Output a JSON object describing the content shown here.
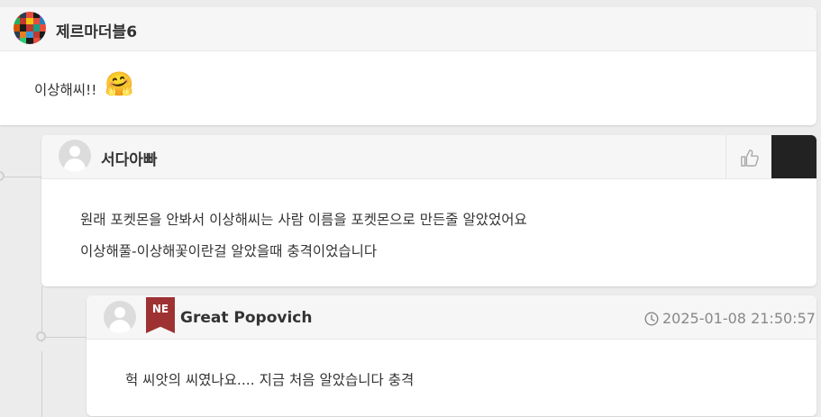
{
  "comments": [
    {
      "author": "제르마더블6",
      "text": "이상해씨!!",
      "emoji": "🤗"
    },
    {
      "author": "서다아빠",
      "lines": [
        "원래 포켓몬을 안봐서 이상해씨는 사람 이름을 포켓몬으로 만든줄 알았었어요",
        "이상해풀-이상해꽃이란걸 알았을때 충격이었습니다"
      ]
    },
    {
      "author": "Great Popovich",
      "badge": "NE",
      "timestamp": "2025-01-08 21:50:57",
      "text": "헉 씨앗의 씨였나요.... 지금 처음 알았습니다 충격"
    }
  ],
  "icons": {
    "like": "thumbs-up-icon",
    "clock": "clock-icon"
  },
  "colors": {
    "badge": "#9e3232",
    "dark_button": "#222222",
    "timestamp": "#888888"
  }
}
